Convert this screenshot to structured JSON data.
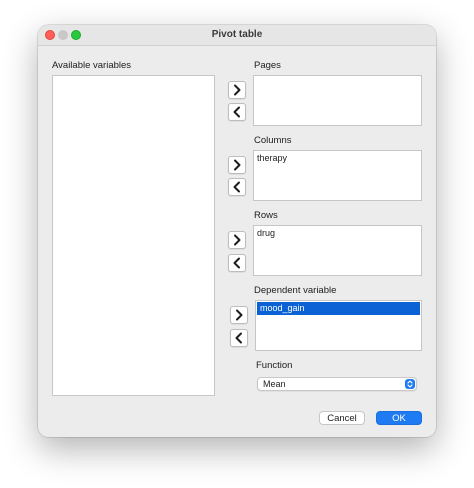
{
  "window": {
    "title": "Pivot table"
  },
  "available": {
    "label": "Available variables",
    "items": []
  },
  "pages": {
    "label": "Pages",
    "items": []
  },
  "columns": {
    "label": "Columns",
    "items": [
      "therapy"
    ]
  },
  "rows": {
    "label": "Rows",
    "items": [
      "drug"
    ]
  },
  "dependent": {
    "label": "Dependent variable",
    "items": [
      "mood_gain"
    ],
    "selected": "mood_gain"
  },
  "function": {
    "label": "Function",
    "value": "Mean"
  },
  "buttons": {
    "cancel": "Cancel",
    "ok": "OK"
  },
  "colors": {
    "accent": "#1f7bf2",
    "selection": "#0a62d4",
    "close": "#ff5f57",
    "maximize": "#28c840"
  },
  "icons": {
    "add": "chevron-right-icon",
    "remove": "chevron-left-icon",
    "function_stepper": "up-down-chevron-icon"
  }
}
